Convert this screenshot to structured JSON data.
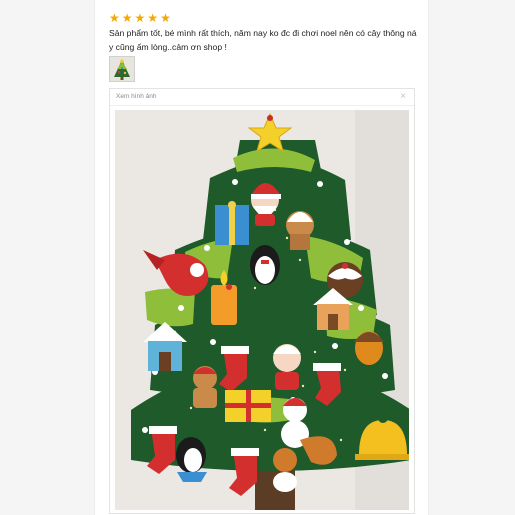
{
  "review": {
    "rating": 5,
    "star_glyph": "★",
    "star_color": "#f6a700",
    "text": "Sản phẩm tốt, bé mình rất thích, năm nay ko đc đi chơi noel nên có cây thông ná y cũng ấm lòng..cảm ơn shop !"
  },
  "viewer": {
    "title": "Xem hình ảnh",
    "close_glyph": "×"
  },
  "photo": {
    "tree_color": "#1e5a2a",
    "light_green": "#8fbf3a",
    "star_color": "#f4d02a"
  }
}
